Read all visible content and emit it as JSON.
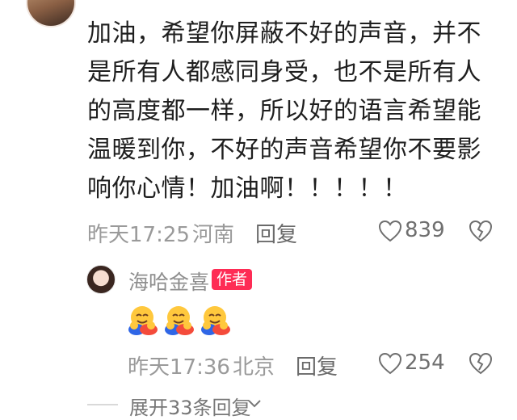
{
  "comment": {
    "text": "加油，希望你屏蔽不好的声音，并不是所有人都感同身受，也不是所有人的高度都一样，所以好的语言希望能温暖到你，不好的声音希望你不要影响你心情！加油啊！！！！！",
    "time": "昨天17:25",
    "location": "河南",
    "separator": "·",
    "reply_label": "回复",
    "likes": "839"
  },
  "reply": {
    "author": "海哈金喜",
    "badge": "作者",
    "emojis": [
      "hugging-face",
      "hugging-face",
      "hugging-face"
    ],
    "time": "昨天17:36",
    "location": "北京",
    "separator": "·",
    "reply_label": "回复",
    "likes": "254"
  },
  "expand": {
    "label": "展开33条回复"
  },
  "colors": {
    "badge": "#fe2c55",
    "meta_text": "#9a9a9a",
    "body_text": "#1f1f1f"
  }
}
